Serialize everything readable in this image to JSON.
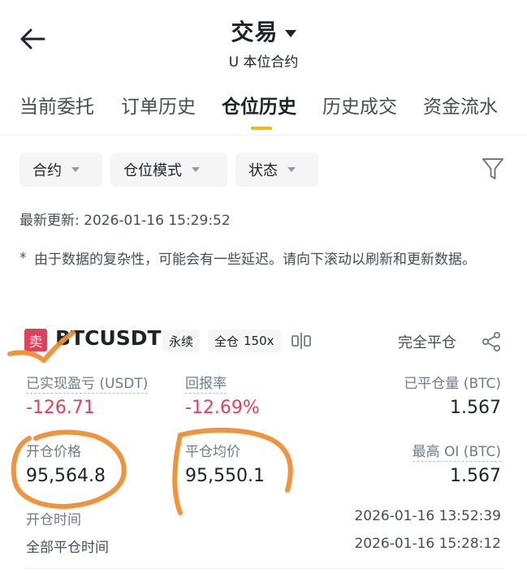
{
  "header": {
    "title": "交易",
    "subtitle": "U 本位合约"
  },
  "tabs": [
    {
      "label": "当前委托",
      "active": false
    },
    {
      "label": "订单历史",
      "active": false
    },
    {
      "label": "仓位历史",
      "active": true
    },
    {
      "label": "历史成交",
      "active": false
    },
    {
      "label": "资金流水",
      "active": false
    }
  ],
  "filters": [
    {
      "label": "合约"
    },
    {
      "label": "仓位模式"
    },
    {
      "label": "状态"
    }
  ],
  "last_updated": "最新更新: 2026-01-16 15:29:52",
  "notice": {
    "star": "*",
    "text": "由于数据的复杂性，可能会有一些延迟。请向下滚动以刷新和更新数据。"
  },
  "position": {
    "side": "卖",
    "symbol": "BTCUSDT",
    "type_tag": "永续",
    "margin_tag": "全仓",
    "leverage": "150x",
    "close_label": "完全平仓",
    "realized_pnl_label": "已实现盈亏 (USDT)",
    "realized_pnl": "-126.71",
    "roi_label": "回报率",
    "roi": "-12.69%",
    "closed_qty_label": "已平仓量 (BTC)",
    "closed_qty": "1.567",
    "entry_price_label": "开仓价格",
    "entry_price": "95,564.8",
    "avg_close_label": "平仓均价",
    "avg_close": "95,550.1",
    "max_oi_label": "最高 OI (BTC)",
    "max_oi": "1.567",
    "open_time_label": "开仓时间",
    "open_time": "2026-01-16 13:52:39",
    "close_time_label": "全部平仓时间",
    "close_time": "2026-01-16 15:28:12"
  },
  "colors": {
    "accent": "#f0b90b",
    "sell": "#e0415a",
    "annotation": "#f08a2c"
  }
}
